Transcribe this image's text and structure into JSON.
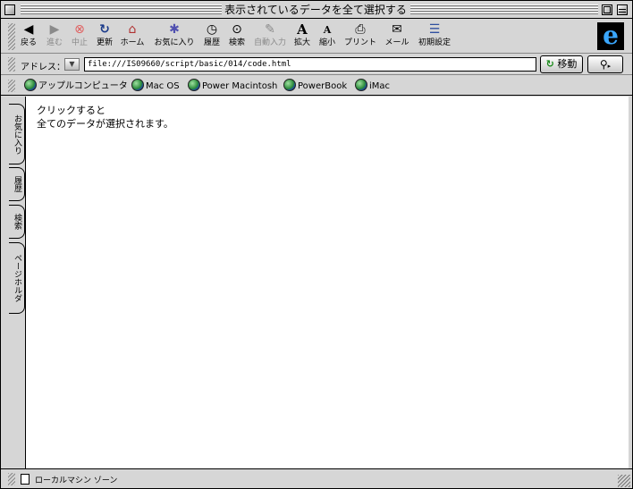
{
  "window": {
    "title": "表示されているデータを全て選択する"
  },
  "toolbar": {
    "buttons": [
      {
        "label": "戻る",
        "icon": "◀"
      },
      {
        "label": "進む",
        "icon": "▶"
      },
      {
        "label": "中止",
        "icon": "⊗"
      },
      {
        "label": "更新",
        "icon": "↻"
      },
      {
        "label": "ホーム",
        "icon": "⌂"
      },
      {
        "label": "お気に入り",
        "icon": "✱"
      },
      {
        "label": "履歴",
        "icon": "◷"
      },
      {
        "label": "検索",
        "icon": "⊙"
      },
      {
        "label": "自動入力",
        "icon": "✎"
      },
      {
        "label": "拡大",
        "icon": "A"
      },
      {
        "label": "縮小",
        "icon": "A"
      },
      {
        "label": "プリント",
        "icon": "⎙"
      },
      {
        "label": "メール",
        "icon": "✉"
      },
      {
        "label": "初期設定",
        "icon": "☰"
      }
    ],
    "logo": "e"
  },
  "address": {
    "label": "アドレス：",
    "url": "file:///IS09660/script/basic/014/code.html",
    "go_label": "移動",
    "go_icon": "↻",
    "search_icon": "⚲"
  },
  "favorites": [
    {
      "label": "アップルコンピュータ"
    },
    {
      "label": "Mac OS"
    },
    {
      "label": "Power Macintosh"
    },
    {
      "label": "PowerBook"
    },
    {
      "label": "iMac"
    }
  ],
  "side_tabs": [
    {
      "label": "お気に入り"
    },
    {
      "label": "履歴"
    },
    {
      "label": "検索"
    },
    {
      "label": "ページホルダ"
    }
  ],
  "content": {
    "line1": "クリックすると",
    "line2": "全てのデータが選択されます。"
  },
  "status": {
    "text": "ローカルマシン ゾーン"
  }
}
